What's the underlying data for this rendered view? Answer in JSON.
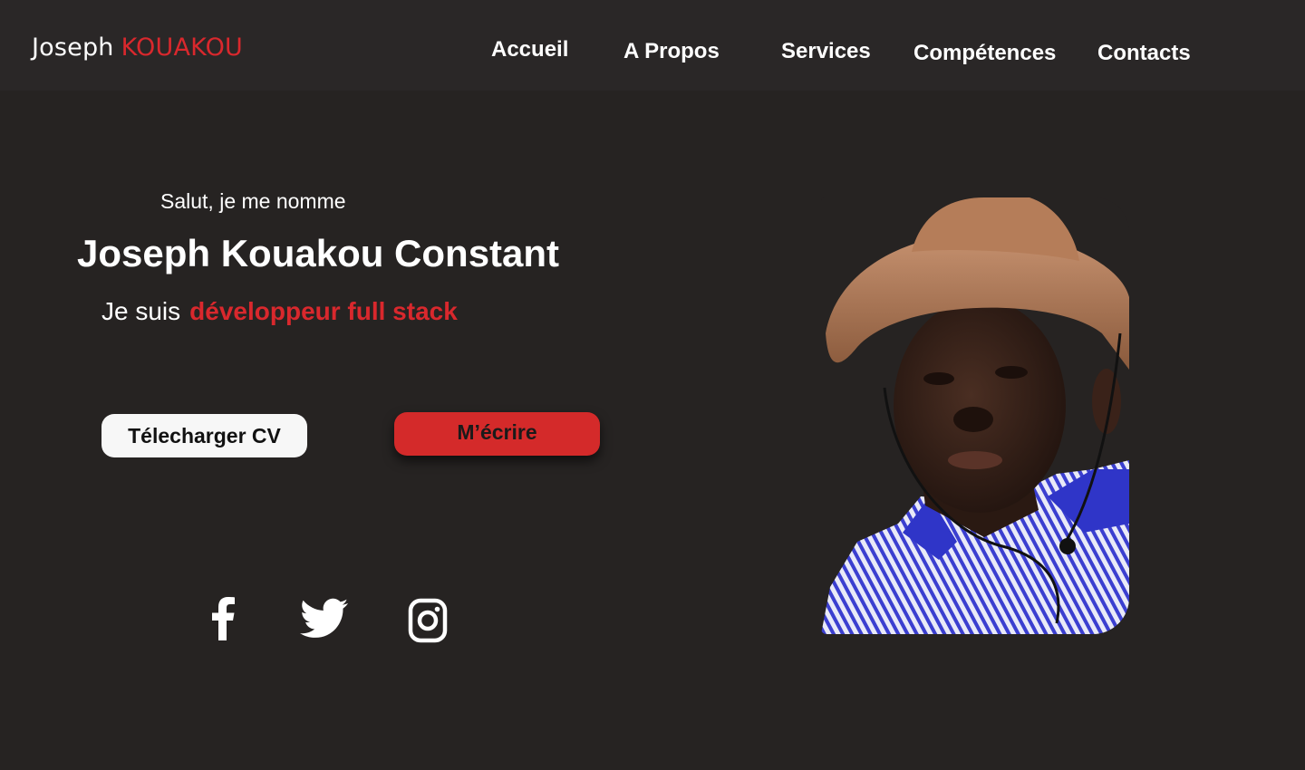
{
  "header": {
    "logo_first": "Joseph",
    "logo_last": "KOUAKOU",
    "nav": [
      {
        "label": "Accueil"
      },
      {
        "label": "A Propos"
      },
      {
        "label": "Services"
      },
      {
        "label": "Compétences"
      },
      {
        "label": "Contacts"
      }
    ]
  },
  "hero": {
    "greeting": "Salut, je me nomme",
    "name": "Joseph Kouakou Constant",
    "role_prefix": "Je suis",
    "role": "développeur full stack",
    "download_cv_label": "Télecharger CV",
    "write_me_label": "M’écrire"
  },
  "social": [
    {
      "icon": "facebook-icon"
    },
    {
      "icon": "twitter-icon"
    },
    {
      "icon": "instagram-icon"
    }
  ],
  "portrait": {
    "description_icon": "portrait-photo"
  },
  "colors": {
    "background": "#262322",
    "header": "#2a2727",
    "accent": "#d9282d",
    "button_light": "#f7f7f7"
  }
}
